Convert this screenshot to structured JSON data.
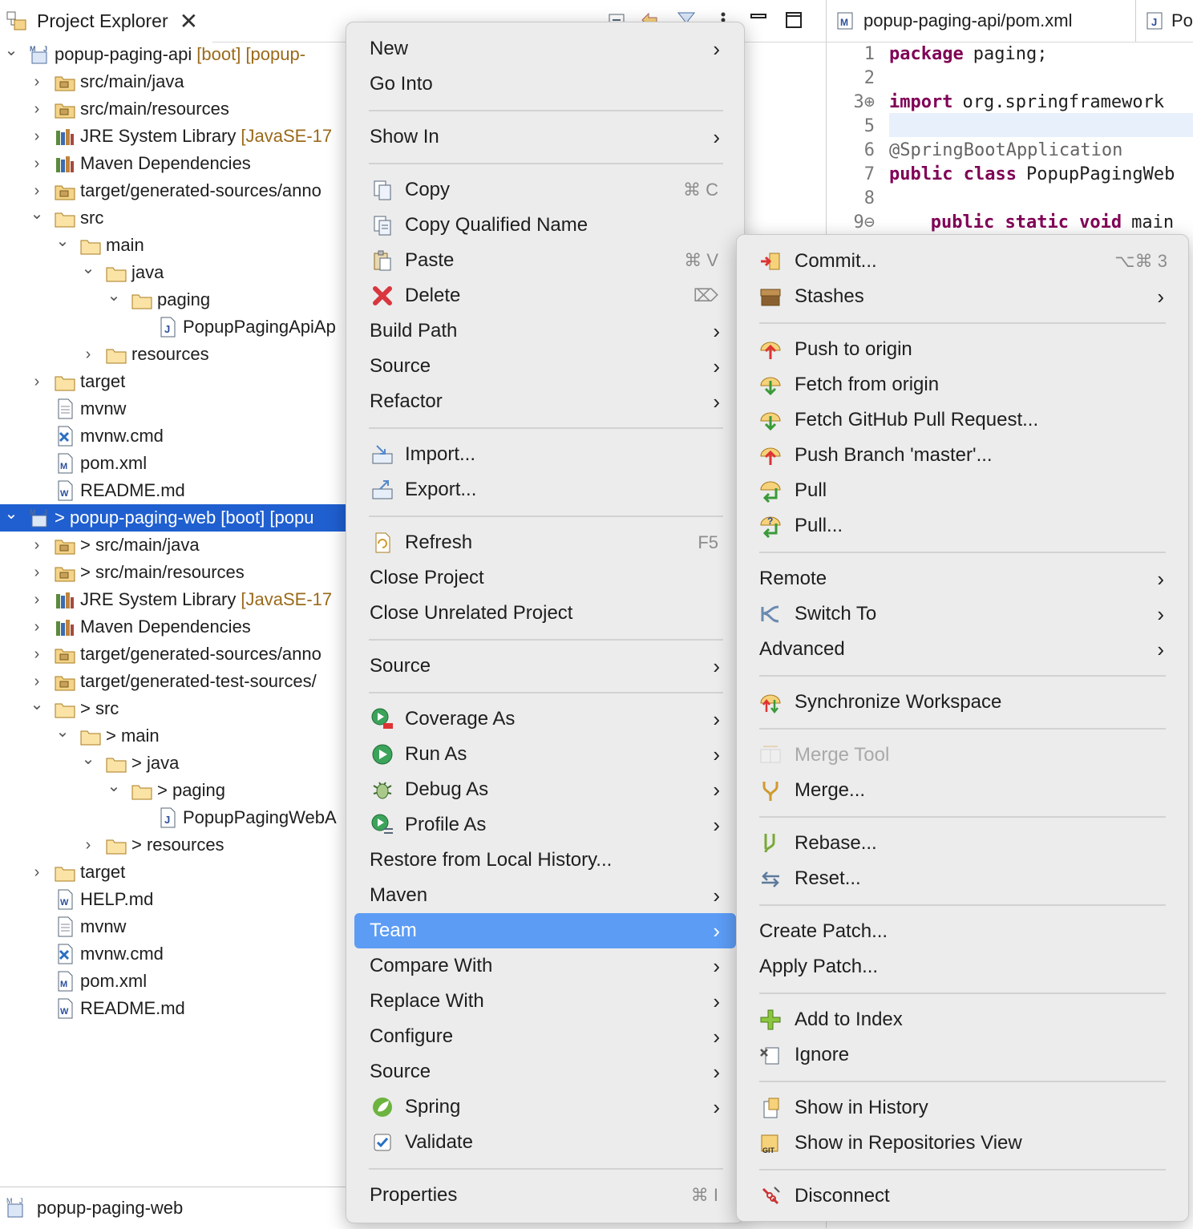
{
  "explorer": {
    "tab_label": "Project Explorer",
    "close_glyph": "✕",
    "rows": [
      {
        "label": "popup-paging-api",
        "deco": "[boot] [popup-",
        "chev": "v",
        "indent": 0,
        "icon": "project-icon"
      },
      {
        "label": "src/main/java",
        "deco": "",
        "chev": ">",
        "indent": 1,
        "icon": "source-folder-icon"
      },
      {
        "label": "src/main/resources",
        "deco": "",
        "chev": ">",
        "indent": 1,
        "icon": "source-folder-icon"
      },
      {
        "label": "JRE System Library",
        "deco": "[JavaSE-17",
        "chev": ">",
        "indent": 1,
        "icon": "library-icon"
      },
      {
        "label": "Maven Dependencies",
        "deco": "",
        "chev": ">",
        "indent": 1,
        "icon": "library-icon"
      },
      {
        "label": "target/generated-sources/anno",
        "deco": "",
        "chev": ">",
        "indent": 1,
        "icon": "source-folder-icon"
      },
      {
        "label": "src",
        "deco": "",
        "chev": "v",
        "indent": 1,
        "icon": "folder-icon"
      },
      {
        "label": "main",
        "deco": "",
        "chev": "v",
        "indent": 2,
        "icon": "folder-icon"
      },
      {
        "label": "java",
        "deco": "",
        "chev": "v",
        "indent": 3,
        "icon": "folder-icon"
      },
      {
        "label": "paging",
        "deco": "",
        "chev": "v",
        "indent": 4,
        "icon": "folder-icon"
      },
      {
        "label": "PopupPagingApiAp",
        "deco": "",
        "chev": "",
        "indent": 5,
        "icon": "java-file-icon"
      },
      {
        "label": "resources",
        "deco": "",
        "chev": ">",
        "indent": 3,
        "icon": "folder-icon"
      },
      {
        "label": "target",
        "deco": "",
        "chev": ">",
        "indent": 1,
        "icon": "folder-icon"
      },
      {
        "label": "mvnw",
        "deco": "",
        "chev": "",
        "indent": 1,
        "icon": "file-icon"
      },
      {
        "label": "mvnw.cmd",
        "deco": "",
        "chev": "",
        "indent": 1,
        "icon": "cmd-file-icon"
      },
      {
        "label": "pom.xml",
        "deco": "",
        "chev": "",
        "indent": 1,
        "icon": "pom-file-icon"
      },
      {
        "label": "README.md",
        "deco": "",
        "chev": "",
        "indent": 1,
        "icon": "markdown-file-icon"
      },
      {
        "label": "> popup-paging-web",
        "deco": "[boot] [popu",
        "chev": "v",
        "indent": 0,
        "icon": "project-icon",
        "selected": true
      },
      {
        "label": "> src/main/java",
        "deco": "",
        "chev": ">",
        "indent": 1,
        "icon": "source-folder-icon"
      },
      {
        "label": "> src/main/resources",
        "deco": "",
        "chev": ">",
        "indent": 1,
        "icon": "source-folder-icon"
      },
      {
        "label": "JRE System Library",
        "deco": "[JavaSE-17",
        "chev": ">",
        "indent": 1,
        "icon": "library-icon"
      },
      {
        "label": "Maven Dependencies",
        "deco": "",
        "chev": ">",
        "indent": 1,
        "icon": "library-icon"
      },
      {
        "label": "target/generated-sources/anno",
        "deco": "",
        "chev": ">",
        "indent": 1,
        "icon": "source-folder-icon"
      },
      {
        "label": "target/generated-test-sources/",
        "deco": "",
        "chev": ">",
        "indent": 1,
        "icon": "source-folder-icon"
      },
      {
        "label": "> src",
        "deco": "",
        "chev": "v",
        "indent": 1,
        "icon": "folder-icon"
      },
      {
        "label": "> main",
        "deco": "",
        "chev": "v",
        "indent": 2,
        "icon": "folder-icon"
      },
      {
        "label": "> java",
        "deco": "",
        "chev": "v",
        "indent": 3,
        "icon": "folder-icon"
      },
      {
        "label": "> paging",
        "deco": "",
        "chev": "v",
        "indent": 4,
        "icon": "folder-icon"
      },
      {
        "label": "PopupPagingWebA",
        "deco": "",
        "chev": "",
        "indent": 5,
        "icon": "java-file-icon"
      },
      {
        "label": "> resources",
        "deco": "",
        "chev": ">",
        "indent": 3,
        "icon": "folder-icon"
      },
      {
        "label": "target",
        "deco": "",
        "chev": ">",
        "indent": 1,
        "icon": "folder-icon"
      },
      {
        "label": "HELP.md",
        "deco": "",
        "chev": "",
        "indent": 1,
        "icon": "markdown-file-icon"
      },
      {
        "label": "mvnw",
        "deco": "",
        "chev": "",
        "indent": 1,
        "icon": "file-icon"
      },
      {
        "label": "mvnw.cmd",
        "deco": "",
        "chev": "",
        "indent": 1,
        "icon": "cmd-file-icon"
      },
      {
        "label": "pom.xml",
        "deco": "",
        "chev": "",
        "indent": 1,
        "icon": "pom-file-icon"
      },
      {
        "label": "README.md",
        "deco": "",
        "chev": "",
        "indent": 1,
        "icon": "markdown-file-icon"
      }
    ],
    "status": "popup-paging-web"
  },
  "editor": {
    "tabs": [
      "popup-paging-api/pom.xml",
      "Po"
    ],
    "lines": [
      {
        "n": "1",
        "parts": [
          [
            "kw",
            "package"
          ],
          [
            "",
            "paging;"
          ]
        ]
      },
      {
        "n": "2",
        "parts": []
      },
      {
        "n": "3⊕",
        "parts": [
          [
            "kw",
            "import"
          ],
          [
            "",
            "org.springframework"
          ]
        ]
      },
      {
        "n": "5",
        "parts": []
      },
      {
        "n": "6",
        "parts": [
          [
            "ann",
            "@SpringBootApplication"
          ]
        ]
      },
      {
        "n": "7",
        "parts": [
          [
            "kw",
            "public class"
          ],
          [
            "",
            "PopupPagingWeb"
          ]
        ]
      },
      {
        "n": "8",
        "parts": []
      },
      {
        "n": "9⊖",
        "parts": [
          [
            "",
            "   "
          ],
          [
            "kw",
            "public static void"
          ],
          [
            "",
            "main"
          ]
        ]
      }
    ]
  },
  "context_menu": {
    "items": [
      {
        "type": "item",
        "label": "New",
        "arrow": true
      },
      {
        "type": "item",
        "label": "Go Into"
      },
      {
        "type": "sep"
      },
      {
        "type": "item",
        "label": "Show In",
        "arrow": true
      },
      {
        "type": "sep"
      },
      {
        "type": "item",
        "label": "Copy",
        "icon": "copy-icon",
        "shortcut": "⌘ C"
      },
      {
        "type": "item",
        "label": "Copy Qualified Name",
        "icon": "copy-qualified-name-icon"
      },
      {
        "type": "item",
        "label": "Paste",
        "icon": "paste-icon",
        "shortcut": "⌘ V"
      },
      {
        "type": "item",
        "label": "Delete",
        "icon": "delete-icon",
        "shortcut": "⌦"
      },
      {
        "type": "item",
        "label": "Build Path",
        "arrow": true
      },
      {
        "type": "item",
        "label": "Source",
        "arrow": true
      },
      {
        "type": "item",
        "label": "Refactor",
        "arrow": true
      },
      {
        "type": "sep"
      },
      {
        "type": "item",
        "label": "Import...",
        "icon": "import-icon"
      },
      {
        "type": "item",
        "label": "Export...",
        "icon": "export-icon"
      },
      {
        "type": "sep"
      },
      {
        "type": "item",
        "label": "Refresh",
        "icon": "refresh-icon",
        "shortcut": "F5"
      },
      {
        "type": "item",
        "label": "Close Project"
      },
      {
        "type": "item",
        "label": "Close Unrelated Project"
      },
      {
        "type": "sep"
      },
      {
        "type": "item",
        "label": "Source",
        "arrow": true
      },
      {
        "type": "sep"
      },
      {
        "type": "item",
        "label": "Coverage As",
        "icon": "coverage-icon",
        "arrow": true
      },
      {
        "type": "item",
        "label": "Run As",
        "icon": "run-icon",
        "arrow": true
      },
      {
        "type": "item",
        "label": "Debug As",
        "icon": "debug-icon",
        "arrow": true
      },
      {
        "type": "item",
        "label": "Profile As",
        "icon": "profile-icon",
        "arrow": true
      },
      {
        "type": "item",
        "label": "Restore from Local History..."
      },
      {
        "type": "item",
        "label": "Maven",
        "arrow": true
      },
      {
        "type": "item",
        "label": "Team",
        "arrow": true,
        "highlighted": true
      },
      {
        "type": "item",
        "label": "Compare With",
        "arrow": true
      },
      {
        "type": "item",
        "label": "Replace With",
        "arrow": true
      },
      {
        "type": "item",
        "label": "Configure",
        "arrow": true
      },
      {
        "type": "item",
        "label": "Source",
        "arrow": true
      },
      {
        "type": "item",
        "label": "Spring",
        "icon": "spring-icon",
        "arrow": true
      },
      {
        "type": "item",
        "label": "Validate",
        "icon": "validate-checkbox-icon"
      },
      {
        "type": "sep"
      },
      {
        "type": "item",
        "label": "Properties",
        "shortcut": "⌘ I"
      }
    ]
  },
  "team_menu": {
    "items": [
      {
        "type": "item",
        "label": "Commit...",
        "icon": "commit-icon",
        "shortcut": "⌥⌘ 3"
      },
      {
        "type": "item",
        "label": "Stashes",
        "icon": "stashes-icon",
        "arrow": true
      },
      {
        "type": "sep"
      },
      {
        "type": "item",
        "label": "Push to origin",
        "icon": "push-icon"
      },
      {
        "type": "item",
        "label": "Fetch from origin",
        "icon": "fetch-icon"
      },
      {
        "type": "item",
        "label": "Fetch GitHub Pull Request...",
        "icon": "fetch-icon"
      },
      {
        "type": "item",
        "label": "Push Branch 'master'...",
        "icon": "push-icon"
      },
      {
        "type": "item",
        "label": "Pull",
        "icon": "pull-icon"
      },
      {
        "type": "item",
        "label": "Pull...",
        "icon": "pull-dialog-icon"
      },
      {
        "type": "sep"
      },
      {
        "type": "item",
        "label": "Remote",
        "arrow": true
      },
      {
        "type": "item",
        "label": "Switch To",
        "icon": "switch-branch-icon",
        "arrow": true
      },
      {
        "type": "item",
        "label": "Advanced",
        "arrow": true
      },
      {
        "type": "sep"
      },
      {
        "type": "item",
        "label": "Synchronize Workspace",
        "icon": "synchronize-icon"
      },
      {
        "type": "sep"
      },
      {
        "type": "item",
        "label": "Merge Tool",
        "icon": "merge-tool-icon",
        "disabled": true
      },
      {
        "type": "item",
        "label": "Merge...",
        "icon": "merge-icon"
      },
      {
        "type": "sep"
      },
      {
        "type": "item",
        "label": "Rebase...",
        "icon": "rebase-icon"
      },
      {
        "type": "item",
        "label": "Reset...",
        "icon": "reset-icon"
      },
      {
        "type": "sep"
      },
      {
        "type": "item",
        "label": "Create Patch..."
      },
      {
        "type": "item",
        "label": "Apply Patch..."
      },
      {
        "type": "sep"
      },
      {
        "type": "item",
        "label": "Add to Index",
        "icon": "add-to-index-icon"
      },
      {
        "type": "item",
        "label": "Ignore",
        "icon": "ignore-icon"
      },
      {
        "type": "sep"
      },
      {
        "type": "item",
        "label": "Show in History",
        "icon": "history-icon"
      },
      {
        "type": "item",
        "label": "Show in Repositories View",
        "icon": "repositories-icon"
      },
      {
        "type": "sep"
      },
      {
        "type": "item",
        "label": "Disconnect",
        "icon": "disconnect-icon"
      }
    ]
  },
  "colors": {
    "selection": "#1f5fd0",
    "menu_highlight": "#5c9cf5",
    "decoration": "#9a6a1a",
    "keyword": "#7f0055"
  }
}
